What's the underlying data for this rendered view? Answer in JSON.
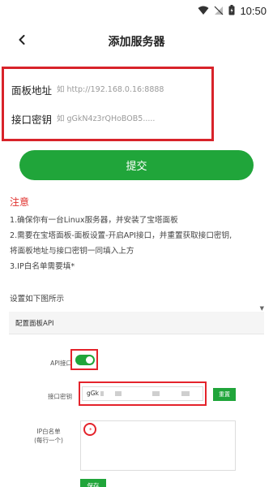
{
  "status_bar": {
    "time": "10:50"
  },
  "header": {
    "title": "添加服务器"
  },
  "form": {
    "panel_address": {
      "label": "面板地址",
      "placeholder": "如 http://192.168.0.16:8888"
    },
    "api_key": {
      "label": "接口密钥",
      "placeholder": "如 gGkN4z3rQHoBOB5....."
    }
  },
  "submit_label": "提交",
  "notice": {
    "title": "注意",
    "lines": [
      "1.确保你有一台Linux服务器，并安装了宝塔面板",
      "2.需要在宝塔面板-面板设置-开启API接口，并重置获取接口密钥,",
      "将面板地址与接口密钥一同填入上方",
      "3.IP白名单需要填*"
    ]
  },
  "example": {
    "caption": "设置如下图所示",
    "header_title": "配置面板API",
    "api_label": "API接口",
    "api_enabled": true,
    "key_label": "接口密钥",
    "key_value": "gGk",
    "reset_label": "重置",
    "ip_label_line1": "IP白名单",
    "ip_label_line2": "(每行一个)",
    "ip_value": "*",
    "save_label": "保存"
  },
  "colors": {
    "accent": "#20a53a",
    "highlight": "#d8232a",
    "notice": "#e0312e"
  }
}
